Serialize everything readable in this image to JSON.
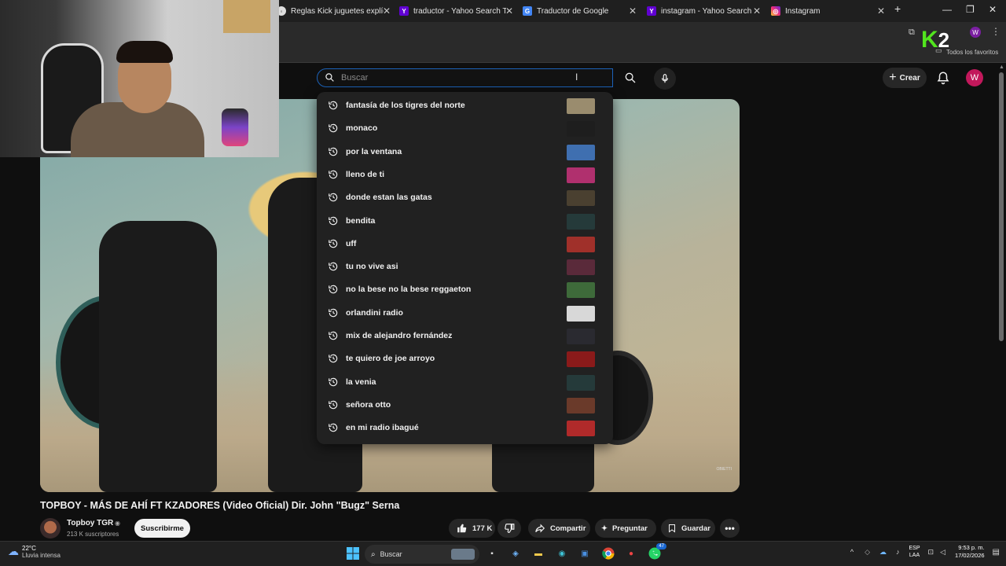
{
  "browser": {
    "tabs": [
      {
        "title": "Reglas Kick juguetes explícitos",
        "icon": "generic-page-icon"
      },
      {
        "title": "traductor - Yahoo Search Tus r",
        "icon": "yahoo-icon"
      },
      {
        "title": "Traductor de Google",
        "icon": "google-translate-icon"
      },
      {
        "title": "instagram - Yahoo Search Tus r",
        "icon": "yahoo-icon"
      },
      {
        "title": "Instagram",
        "icon": "instagram-icon"
      }
    ],
    "new_tab": "+",
    "profile_initial": "W",
    "favorites_label": "Todos los favoritos"
  },
  "overlay": {
    "logo_k": "K",
    "logo_2": "2"
  },
  "youtube": {
    "search": {
      "placeholder": "Buscar",
      "value": ""
    },
    "create_label": "Crear",
    "avatar_initial": "W",
    "suggestions": [
      {
        "text": "fantasía de los tigres del norte",
        "thumb_color": "#9a8c6e"
      },
      {
        "text": "monaco",
        "thumb_color": "#1e1e1e"
      },
      {
        "text": "por la ventana",
        "thumb_color": "#3f6fb0"
      },
      {
        "text": "lleno de ti",
        "thumb_color": "#b0306e"
      },
      {
        "text": "donde estan las gatas",
        "thumb_color": "#4a4030"
      },
      {
        "text": "bendita",
        "thumb_color": "#253a3a"
      },
      {
        "text": "uff",
        "thumb_color": "#a0302a"
      },
      {
        "text": "tu no vive asi",
        "thumb_color": "#5a2a3a"
      },
      {
        "text": "no la bese no la bese reggaeton",
        "thumb_color": "#3e6a3a"
      },
      {
        "text": "orlandini radio",
        "thumb_color": "#d8d8d8"
      },
      {
        "text": "mix de alejandro fernández",
        "thumb_color": "#2a2a30"
      },
      {
        "text": "te quiero de joe arroyo",
        "thumb_color": "#8a1a1a"
      },
      {
        "text": "la venia",
        "thumb_color": "#253a3a"
      },
      {
        "text": "señora otto",
        "thumb_color": "#6a3a2a"
      },
      {
        "text": "en mi radio ibagué",
        "thumb_color": "#b02a2a"
      }
    ],
    "video": {
      "title": "TOPBOY - MÁS DE AHÍ FT KZADORES (Video Oficial) Dir. John \"Bugz\" Serna",
      "watermark": "OBIETTI",
      "channel_name": "Topboy TGR",
      "subscribers": "213 K suscriptores",
      "subscribe_label": "Suscribirme",
      "likes": "177 K",
      "share_label": "Compartir",
      "ask_label": "Preguntar",
      "save_label": "Guardar"
    }
  },
  "taskbar": {
    "weather_temp": "22°C",
    "weather_condition": "Lluvia intensa",
    "search_label": "Buscar",
    "chat_badge": "47",
    "lang_top": "ESP",
    "lang_bottom": "LAA",
    "time": "9:53 p. m.",
    "date": "17/02/2026"
  }
}
